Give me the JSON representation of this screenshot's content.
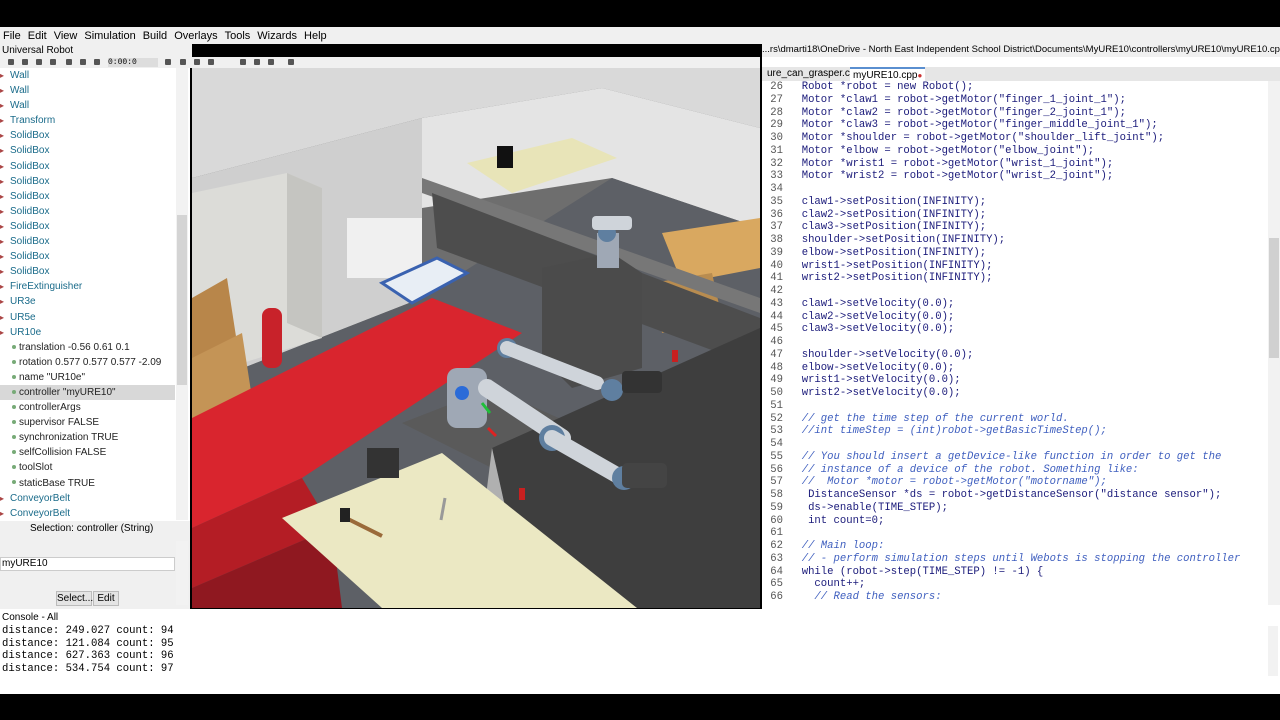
{
  "menu": [
    "File",
    "Edit",
    "View",
    "Simulation",
    "Build",
    "Overlays",
    "Tools",
    "Wizards",
    "Help"
  ],
  "left_panel": {
    "title": "Universal Robot",
    "tree": [
      {
        "label": "Wall",
        "type": "node"
      },
      {
        "label": "Wall",
        "type": "node"
      },
      {
        "label": "Wall",
        "type": "node"
      },
      {
        "label": "Transform",
        "type": "node"
      },
      {
        "label": "SolidBox",
        "type": "node"
      },
      {
        "label": "SolidBox",
        "type": "node"
      },
      {
        "label": "SolidBox",
        "type": "node"
      },
      {
        "label": "SolidBox",
        "type": "node"
      },
      {
        "label": "SolidBox",
        "type": "node"
      },
      {
        "label": "SolidBox",
        "type": "node"
      },
      {
        "label": "SolidBox",
        "type": "node"
      },
      {
        "label": "SolidBox",
        "type": "node"
      },
      {
        "label": "SolidBox",
        "type": "node"
      },
      {
        "label": "SolidBox",
        "type": "node"
      },
      {
        "label": "FireExtinguisher",
        "type": "node"
      },
      {
        "label": "UR3e",
        "type": "node"
      },
      {
        "label": "UR5e",
        "type": "node"
      },
      {
        "label": "UR10e",
        "type": "node"
      },
      {
        "label": "translation -0.56 0.61 0.1",
        "type": "field"
      },
      {
        "label": "rotation 0.577 0.577 0.577 -2.09",
        "type": "field"
      },
      {
        "label": "name \"UR10e\"",
        "type": "field"
      },
      {
        "label": "controller \"myURE10\"",
        "type": "field",
        "selected": true
      },
      {
        "label": "controllerArgs",
        "type": "field"
      },
      {
        "label": "supervisor FALSE",
        "type": "field"
      },
      {
        "label": "synchronization TRUE",
        "type": "field"
      },
      {
        "label": "selfCollision FALSE",
        "type": "field"
      },
      {
        "label": "toolSlot",
        "type": "field"
      },
      {
        "label": "staticBase TRUE",
        "type": "field"
      },
      {
        "label": "ConveyorBelt",
        "type": "node"
      },
      {
        "label": "ConveyorBelt",
        "type": "node"
      }
    ],
    "selection_label": "Selection: controller (String)",
    "selection_value": "myURE10",
    "select_button": "Select...",
    "edit_button": "Edit"
  },
  "toolbar": {
    "time": "0:00:0",
    "icons": [
      "open-world-icon",
      "save-icon",
      "reload-icon",
      "undo-icon",
      "redo-icon",
      "add-icon",
      "delete-icon",
      "reset-icon",
      "play-icon",
      "step-icon",
      "fast-icon",
      "stop-icon",
      "record-icon",
      "screenshot-icon",
      "volume-icon"
    ]
  },
  "editor": {
    "path": "...rs\\dmarti18\\OneDrive - North East Independent School District\\Documents\\MyURE10\\controllers\\myURE10\\myURE10.cpp",
    "tabs": [
      "ure_can_grasper.c",
      "myURE10.cpp"
    ],
    "active_tab": 1,
    "lines": [
      {
        "n": "26",
        "t": "  Robot *robot = new Robot();"
      },
      {
        "n": "27",
        "t": "  Motor *claw1 = robot->getMotor(\"finger_1_joint_1\");"
      },
      {
        "n": "28",
        "t": "  Motor *claw2 = robot->getMotor(\"finger_2_joint_1\");"
      },
      {
        "n": "29",
        "t": "  Motor *claw3 = robot->getMotor(\"finger_middle_joint_1\");"
      },
      {
        "n": "30",
        "t": "  Motor *shoulder = robot->getMotor(\"shoulder_lift_joint\");"
      },
      {
        "n": "31",
        "t": "  Motor *elbow = robot->getMotor(\"elbow_joint\");"
      },
      {
        "n": "32",
        "t": "  Motor *wrist1 = robot->getMotor(\"wrist_1_joint\");"
      },
      {
        "n": "33",
        "t": "  Motor *wrist2 = robot->getMotor(\"wrist_2_joint\");"
      },
      {
        "n": "34",
        "t": ""
      },
      {
        "n": "35",
        "t": "  claw1->setPosition(INFINITY);"
      },
      {
        "n": "36",
        "t": "  claw2->setPosition(INFINITY);"
      },
      {
        "n": "37",
        "t": "  claw3->setPosition(INFINITY);"
      },
      {
        "n": "38",
        "t": "  shoulder->setPosition(INFINITY);"
      },
      {
        "n": "39",
        "t": "  elbow->setPosition(INFINITY);"
      },
      {
        "n": "40",
        "t": "  wrist1->setPosition(INFINITY);"
      },
      {
        "n": "41",
        "t": "  wrist2->setPosition(INFINITY);"
      },
      {
        "n": "42",
        "t": ""
      },
      {
        "n": "43",
        "t": "  claw1->setVelocity(0.0);"
      },
      {
        "n": "44",
        "t": "  claw2->setVelocity(0.0);"
      },
      {
        "n": "45",
        "t": "  claw3->setVelocity(0.0);"
      },
      {
        "n": "46",
        "t": ""
      },
      {
        "n": "47",
        "t": "  shoulder->setVelocity(0.0);"
      },
      {
        "n": "48",
        "t": "  elbow->setVelocity(0.0);"
      },
      {
        "n": "49",
        "t": "  wrist1->setVelocity(0.0);"
      },
      {
        "n": "50",
        "t": "  wrist2->setVelocity(0.0);"
      },
      {
        "n": "51",
        "t": ""
      },
      {
        "n": "52",
        "t": "  // get the time step of the current world.",
        "c": true
      },
      {
        "n": "53",
        "t": "  //int timeStep = (int)robot->getBasicTimeStep();",
        "c": true
      },
      {
        "n": "54",
        "t": ""
      },
      {
        "n": "55",
        "t": "  // You should insert a getDevice-like function in order to get the",
        "c": true
      },
      {
        "n": "56",
        "t": "  // instance of a device of the robot. Something like:",
        "c": true
      },
      {
        "n": "57",
        "t": "  //  Motor *motor = robot->getMotor(\"motorname\");",
        "c": true
      },
      {
        "n": "58",
        "t": "   DistanceSensor *ds = robot->getDistanceSensor(\"distance sensor\");"
      },
      {
        "n": "59",
        "t": "   ds->enable(TIME_STEP);"
      },
      {
        "n": "60",
        "t": "   int count=0;"
      },
      {
        "n": "61",
        "t": ""
      },
      {
        "n": "62",
        "t": "  // Main loop:",
        "c": true
      },
      {
        "n": "63",
        "t": "  // - perform simulation steps until Webots is stopping the controller",
        "c": true
      },
      {
        "n": "64",
        "t": "  while (robot->step(TIME_STEP) != -1) {"
      },
      {
        "n": "65",
        "t": "    count++;"
      },
      {
        "n": "66",
        "t": "    // Read the sensors:",
        "c": true
      }
    ]
  },
  "console": {
    "title": "Console - All",
    "lines": [
      "distance: 249.027 count: 94",
      "distance: 121.084 count: 95",
      "distance: 627.363 count: 96",
      "distance: 534.754 count: 97"
    ]
  },
  "colors": {
    "accent": "#1a6b8a",
    "crate_red": "#d9252e",
    "floor": "#5a5a5a"
  }
}
